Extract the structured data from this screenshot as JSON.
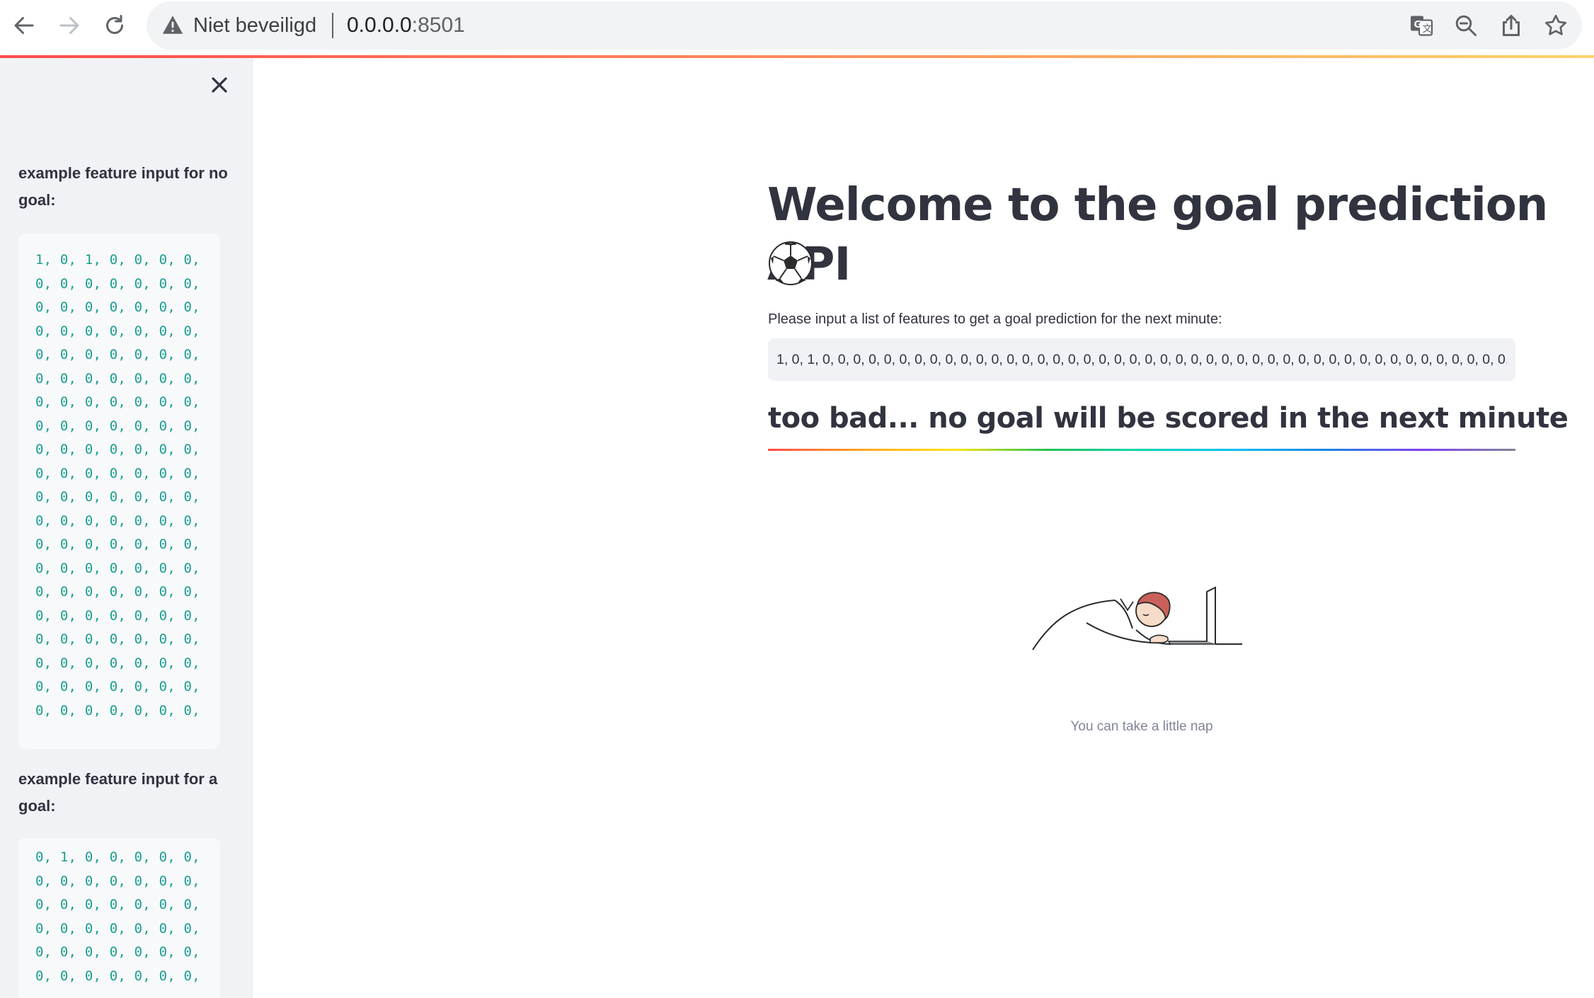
{
  "browser": {
    "security_label": "Niet beveiligd",
    "url_host": "0.0.0.0",
    "url_port": ":8501",
    "icons": [
      "back-arrow-icon",
      "forward-arrow-icon",
      "reload-icon",
      "warning-icon",
      "translate-icon",
      "zoom-icon",
      "share-icon",
      "bookmark-star-icon"
    ]
  },
  "sidebar": {
    "close_icon": "close-icon",
    "no_goal_label": "example feature input for no goal:",
    "no_goal_lines": [
      "1, 0, 1, 0, 0, 0, 0,",
      "0, 0, 0, 0, 0, 0, 0,",
      "0, 0, 0, 0, 0, 0, 0,",
      "0, 0, 0, 0, 0, 0, 0,",
      "0, 0, 0, 0, 0, 0, 0,",
      "0, 0, 0, 0, 0, 0, 0,",
      "0, 0, 0, 0, 0, 0, 0,",
      "0, 0, 0, 0, 0, 0, 0,",
      "0, 0, 0, 0, 0, 0, 0,",
      "0, 0, 0, 0, 0, 0, 0,",
      "0, 0, 0, 0, 0, 0, 0,",
      "0, 0, 0, 0, 0, 0, 0,",
      "0, 0, 0, 0, 0, 0, 0,",
      "0, 0, 0, 0, 0, 0, 0,",
      "0, 0, 0, 0, 0, 0, 0,",
      "0, 0, 0, 0, 0, 0, 0,",
      "0, 0, 0, 0, 0, 0, 0,",
      "0, 0, 0, 0, 0, 0, 0,",
      "0, 0, 0, 0, 0, 0, 0,",
      "0, 0, 0, 0, 0, 0, 0,"
    ],
    "goal_label": "example feature input for a goal:",
    "goal_lines": [
      "0, 1, 0, 0, 0, 0, 0,",
      "0, 0, 0, 0, 0, 0, 0,",
      "0, 0, 0, 0, 0, 0, 0,",
      "0, 0, 0, 0, 0, 0, 0,",
      "0, 0, 0, 0, 0, 0, 0,",
      "0, 0, 0, 0, 0, 0, 0,"
    ]
  },
  "main": {
    "title": "Welcome to the goal prediction API",
    "title_icon": "soccer-ball-icon",
    "input_label": "Please input a list of features to get a goal prediction for the next minute:",
    "input_value": "1, 0, 1, 0, 0, 0, 0, 0, 0, 0, 0, 0, 0, 0, 0, 0, 0, 0, 0, 0, 0, 0, 0, 0, 0, 0, 0, 0, 0, 0, 0, 0, 0, 0, 0, 0, 0, 0, 0, 0, 0, 0, 0, 0, 0, 0, 0, 0, 0, 0, 0",
    "result_heading": "too bad... no goal will be scored in the next minute",
    "image_icon": "sleeping-at-laptop-illustration",
    "caption": "You can take a little nap"
  },
  "colors": {
    "accent": "#ff4b4b",
    "code_text": "#1a9e8f",
    "sidebar_bg": "#f0f2f6",
    "text": "#31333f"
  }
}
